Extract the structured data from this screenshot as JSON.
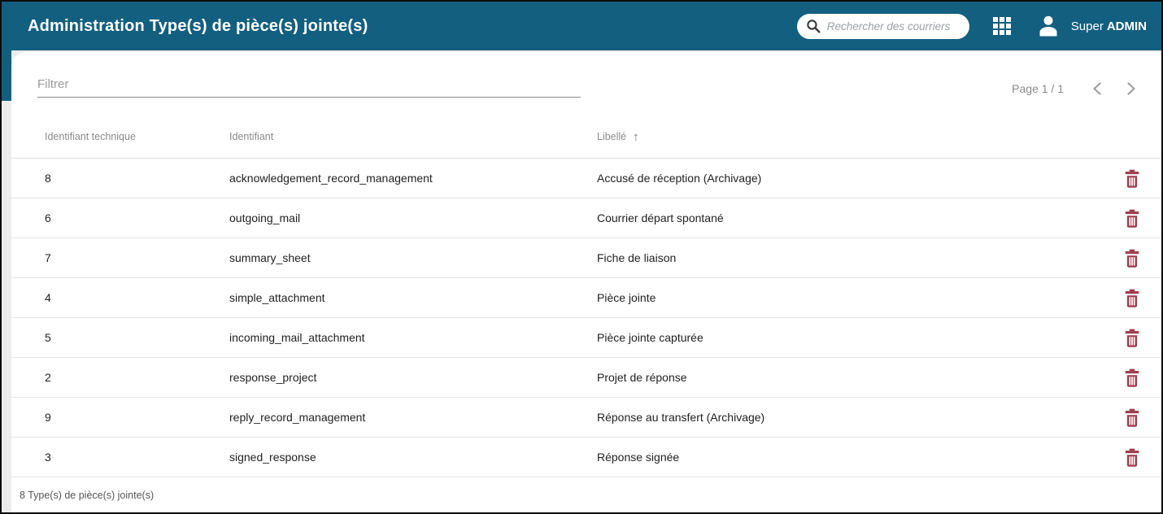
{
  "app": {
    "title": "Administration Type(s) de pièce(s) jointe(s)"
  },
  "header": {
    "search": {
      "placeholder": "Rechercher des courriers"
    },
    "user": {
      "first_name": "Super",
      "last_name": "ADMIN"
    }
  },
  "toolbar": {
    "filter_placeholder": "Filtrer",
    "pagination": "Page 1 / 1"
  },
  "table": {
    "columns": [
      "Identifiant technique",
      "Identifiant",
      "Libellé"
    ],
    "sort_arrow": "↑",
    "sorted_column": "Libellé",
    "rows": [
      {
        "id": "8",
        "identifier": "acknowledgement_record_management",
        "label": "Accusé de réception (Archivage)"
      },
      {
        "id": "6",
        "identifier": "outgoing_mail",
        "label": "Courrier départ spontané"
      },
      {
        "id": "7",
        "identifier": "summary_sheet",
        "label": "Fiche de liaison"
      },
      {
        "id": "4",
        "identifier": "simple_attachment",
        "label": "Pièce jointe"
      },
      {
        "id": "5",
        "identifier": "incoming_mail_attachment",
        "label": "Pièce jointe capturée"
      },
      {
        "id": "2",
        "identifier": "response_project",
        "label": "Projet de réponse"
      },
      {
        "id": "9",
        "identifier": "reply_record_management",
        "label": "Réponse au transfert (Archivage)"
      },
      {
        "id": "3",
        "identifier": "signed_response",
        "label": "Réponse signée"
      }
    ],
    "summary": "8 Type(s) de pièce(s) jointe(s)"
  },
  "colors": {
    "primary_teal": "#135f7f",
    "delete_maroon": "#9d3c4d",
    "page_background": "#ececec",
    "row_border": "#e5e5e5"
  },
  "icons": {
    "search-icon": "magnifier glyph",
    "apps-icon": "3x3 white grid",
    "user-icon": "white person silhouette",
    "sort-asc-icon": "↑",
    "chevron-left-icon": "‹",
    "chevron-right-icon": "›",
    "delete-icon": "maroon trash can"
  }
}
